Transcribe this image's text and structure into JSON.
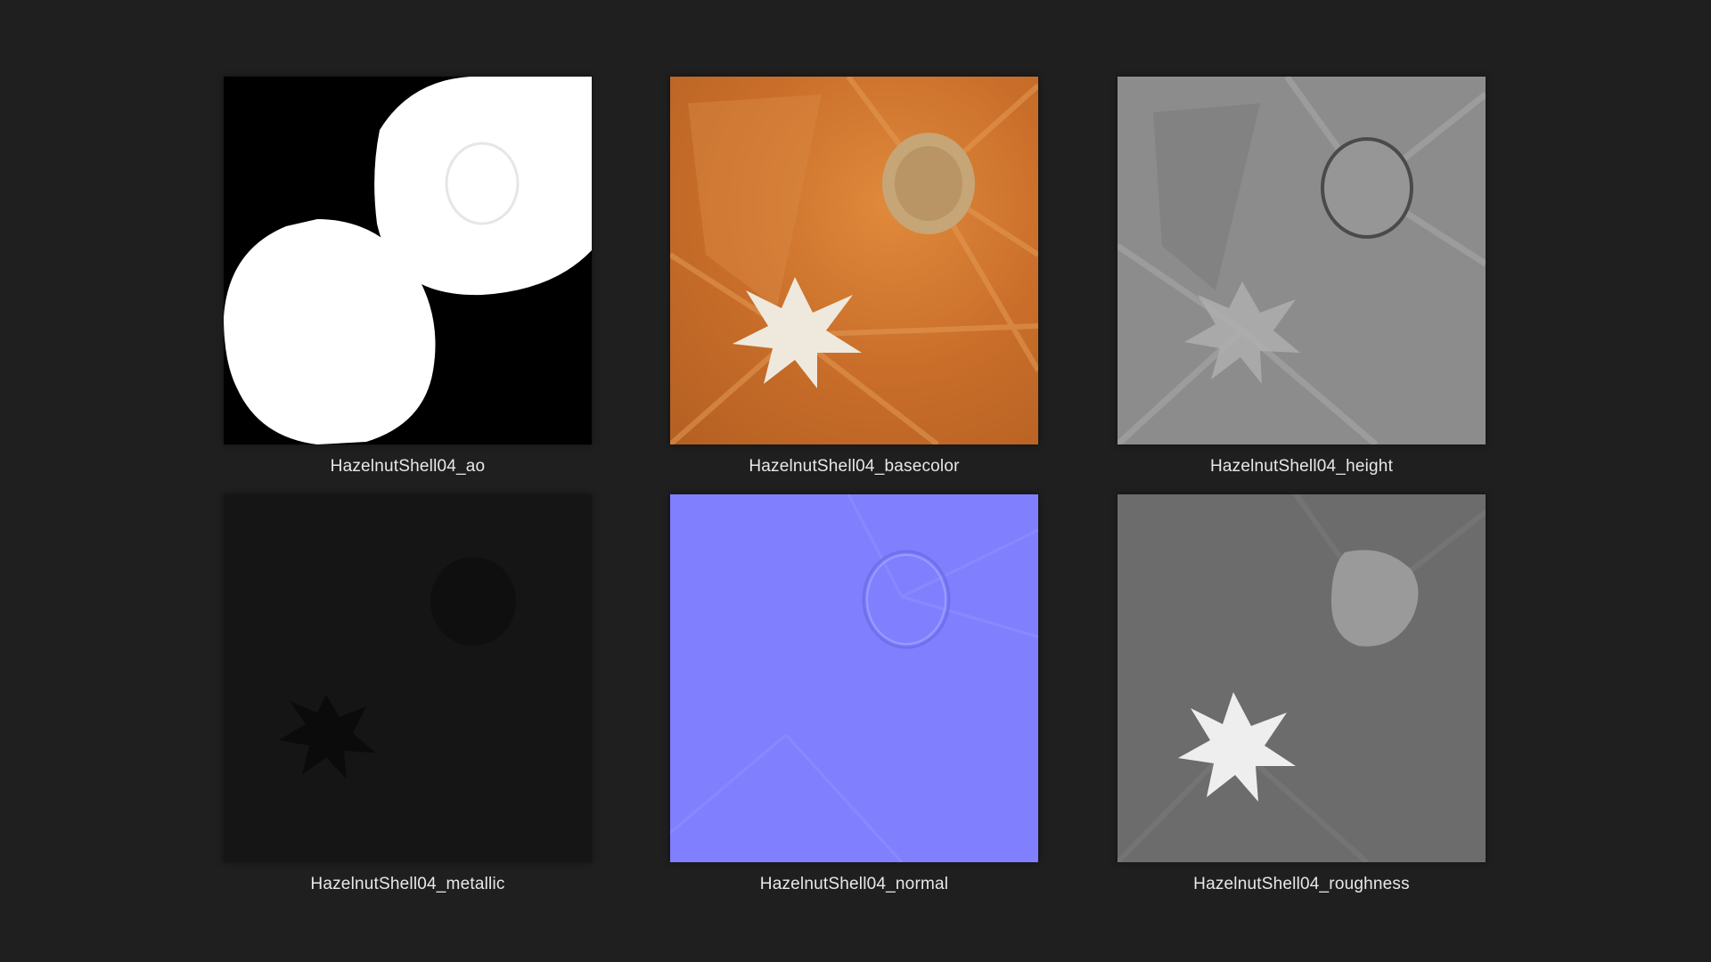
{
  "gallery": {
    "items": [
      {
        "label": "HazelnutShell04_ao"
      },
      {
        "label": "HazelnutShell04_basecolor"
      },
      {
        "label": "HazelnutShell04_height"
      },
      {
        "label": "HazelnutShell04_metallic"
      },
      {
        "label": "HazelnutShell04_normal"
      },
      {
        "label": "HazelnutShell04_roughness"
      }
    ]
  },
  "colors": {
    "background": "#1f1f1f",
    "caption_text": "#e8e8e8",
    "ao_bg": "#000000",
    "ao_fg": "#ffffff",
    "basecolor": "#c9732f",
    "height": "#8a8a8a",
    "metallic": "#141414",
    "normal": "#8080ff",
    "roughness": "#6e6e6e"
  }
}
